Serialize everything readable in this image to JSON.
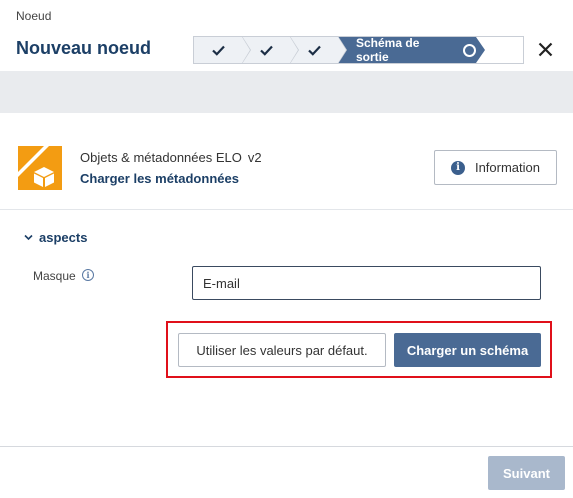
{
  "header": {
    "kicker": "Noeud",
    "title": "Nouveau noeud",
    "close_icon": "close-icon"
  },
  "stepper": {
    "completed_steps": [
      {
        "icon": "check-icon"
      },
      {
        "icon": "check-icon"
      },
      {
        "icon": "check-icon"
      }
    ],
    "active_step": {
      "label": "Schéma de sortie",
      "icon": "circle-icon"
    },
    "active_color": "#4a6a94"
  },
  "object": {
    "icon": "elo-box-icon",
    "name": "Objets & métadonnées ELO",
    "version": "v2",
    "load_metadata_link": "Charger les métadonnées",
    "info_button": "Information"
  },
  "aspects": {
    "section_label": "aspects",
    "mask_label": "Masque",
    "mask_value": "E-mail",
    "default_values_button": "Utiliser les valeurs par défaut.",
    "load_schema_button": "Charger un schéma",
    "highlight_color": "#e0101a"
  },
  "footer": {
    "next_button": "Suivant",
    "next_enabled": false
  }
}
